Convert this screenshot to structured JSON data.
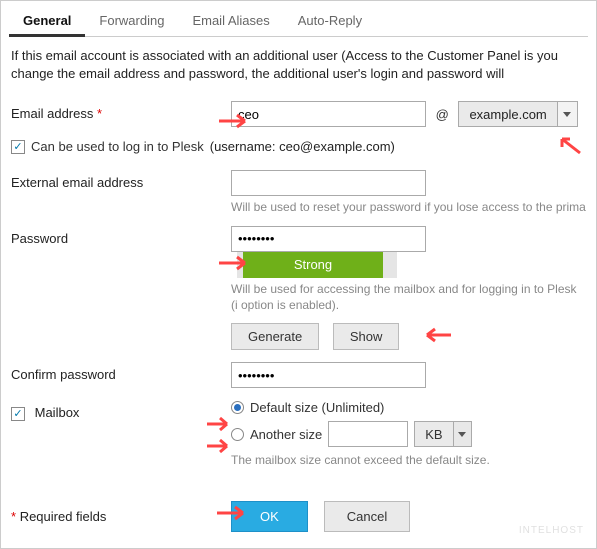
{
  "tabs": {
    "general": "General",
    "forwarding": "Forwarding",
    "aliases": "Email Aliases",
    "autoreply": "Auto-Reply"
  },
  "intro": "If this email account is associated with an additional user (Access to the Customer Panel is you change the email address and password, the additional user's login and password will",
  "labels": {
    "email": "Email address",
    "canlogin": "Can be used to log in to Plesk",
    "loginuser": "(username: ceo@example.com)",
    "external": "External email address",
    "pw": "Password",
    "confirm": "Confirm password",
    "mailbox": "Mailbox"
  },
  "email": {
    "local": "ceo",
    "at": "@",
    "domain": "example.com"
  },
  "hints": {
    "external": "Will be used to reset your password if you lose access to the prima",
    "pw": "Will be used for accessing the mailbox and for logging in to Plesk (i option is enabled).",
    "mailbox": "The mailbox size cannot exceed the default size."
  },
  "pw": {
    "value": "••••••••",
    "strength": "Strong",
    "generate": "Generate",
    "show": "Show"
  },
  "confirm": {
    "value": "••••••••"
  },
  "mailbox": {
    "default": "Default size (Unlimited)",
    "another": "Another size",
    "unit": "KB"
  },
  "footer": {
    "req": "Required fields",
    "ok": "OK",
    "cancel": "Cancel"
  },
  "watermark": "INTELHOST"
}
